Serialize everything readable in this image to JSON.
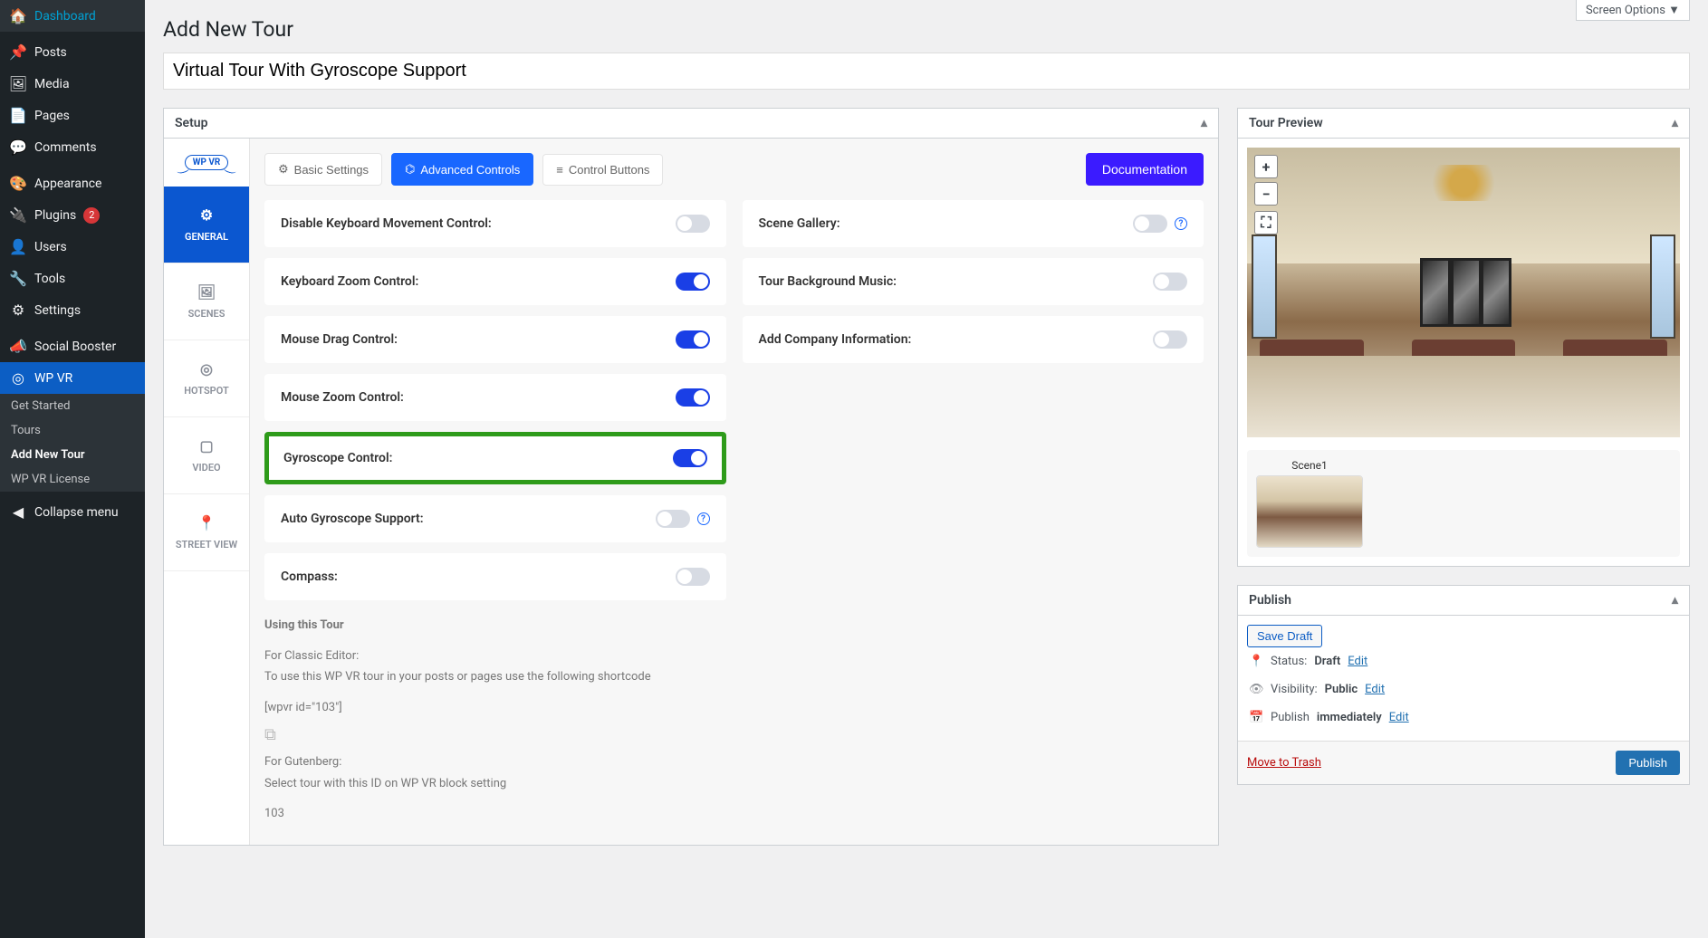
{
  "screen_options": "Screen Options ▼",
  "page_title": "Add New Tour",
  "tour_title": "Virtual Tour With Gyroscope Support",
  "sidebar": {
    "items": [
      {
        "icon": "🏠",
        "label": "Dashboard"
      },
      {
        "icon": "📌",
        "label": "Posts"
      },
      {
        "icon": "🖼",
        "label": "Media"
      },
      {
        "icon": "📄",
        "label": "Pages"
      },
      {
        "icon": "💬",
        "label": "Comments"
      },
      {
        "icon": "🎨",
        "label": "Appearance"
      },
      {
        "icon": "🔌",
        "label": "Plugins",
        "badge": "2"
      },
      {
        "icon": "👤",
        "label": "Users"
      },
      {
        "icon": "🔧",
        "label": "Tools"
      },
      {
        "icon": "⚙",
        "label": "Settings"
      },
      {
        "icon": "📣",
        "label": "Social Booster"
      },
      {
        "icon": "◎",
        "label": "WP VR"
      }
    ],
    "submenu": [
      "Get Started",
      "Tours",
      "Add New Tour",
      "WP VR License"
    ],
    "collapse": "Collapse menu"
  },
  "setup": {
    "header": "Setup",
    "brand": "WP VR",
    "vtabs": [
      {
        "icon": "⚙",
        "label": "GENERAL"
      },
      {
        "icon": "🖼",
        "label": "SCENES"
      },
      {
        "icon": "◎",
        "label": "HOTSPOT"
      },
      {
        "icon": "▢",
        "label": "VIDEO"
      },
      {
        "icon": "📍",
        "label": "STREET VIEW"
      }
    ],
    "tabs": {
      "basic": "Basic Settings",
      "advanced": "Advanced Controls",
      "control_buttons": "Control Buttons"
    },
    "documentation": "Documentation",
    "settings_left": [
      {
        "label": "Disable Keyboard Movement Control:",
        "on": false
      },
      {
        "label": "Keyboard Zoom Control:",
        "on": true
      },
      {
        "label": "Mouse Drag Control:",
        "on": true
      },
      {
        "label": "Mouse Zoom Control:",
        "on": true
      },
      {
        "label": "Gyroscope Control:",
        "on": true,
        "highlight": true
      },
      {
        "label": "Auto Gyroscope Support:",
        "on": false,
        "info": true
      },
      {
        "label": "Compass:",
        "on": false
      }
    ],
    "settings_right": [
      {
        "label": "Scene Gallery:",
        "on": false,
        "info": true
      },
      {
        "label": "Tour Background Music:",
        "on": false
      },
      {
        "label": "Add Company Information:",
        "on": false
      }
    ],
    "usage": {
      "title": "Using this Tour",
      "classic_title": "For Classic Editor:",
      "classic_text": "To use this WP VR tour in your posts or pages use the following shortcode",
      "shortcode": "[wpvr id=\"103\"]",
      "gutenberg_title": "For Gutenberg:",
      "gutenberg_text": "Select tour with this ID on WP VR block setting",
      "id": "103"
    }
  },
  "preview": {
    "header": "Tour Preview",
    "zoom_in": "+",
    "zoom_out": "−",
    "fullscreen": "⛶",
    "scene_label": "Scene1"
  },
  "publish": {
    "header": "Publish",
    "save_draft": "Save Draft",
    "status_label": "Status:",
    "status_value": "Draft",
    "visibility_label": "Visibility:",
    "visibility_value": "Public",
    "schedule_label": "Publish",
    "schedule_value": "immediately",
    "edit": "Edit",
    "trash": "Move to Trash",
    "publish_btn": "Publish"
  }
}
